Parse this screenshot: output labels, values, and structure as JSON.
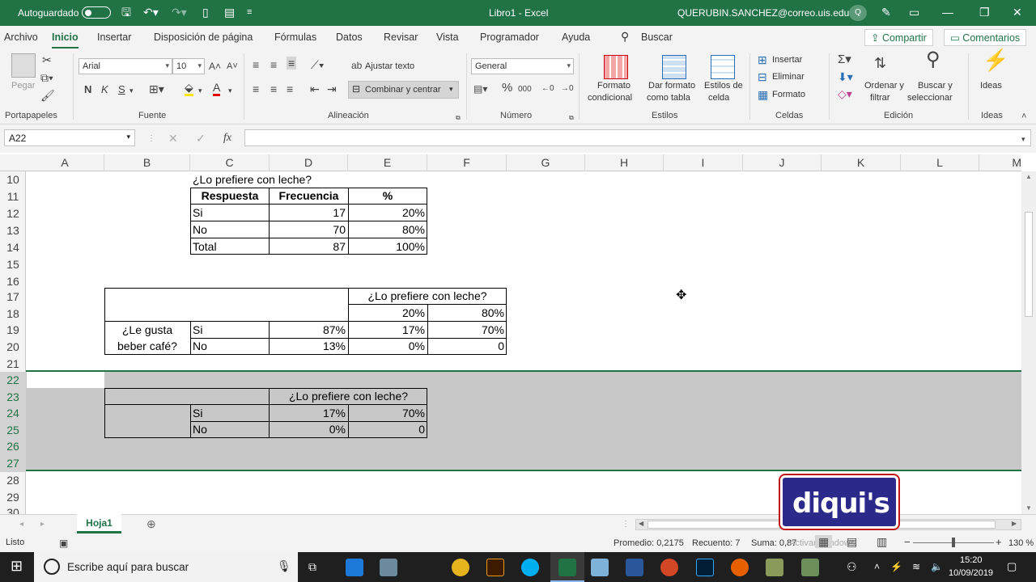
{
  "titlebar": {
    "autosave": "Autoguardado",
    "doc_title": "Libro1  -  Excel",
    "user": "QUERUBIN.SANCHEZ@correo.uis.edu.co",
    "user_initial": "Q"
  },
  "menu": {
    "items": [
      "Archivo",
      "Inicio",
      "Insertar",
      "Disposición de página",
      "Fórmulas",
      "Datos",
      "Revisar",
      "Vista",
      "Programador",
      "Ayuda"
    ],
    "search": "Buscar",
    "share": "Compartir",
    "comments": "Comentarios"
  },
  "ribbon": {
    "paste": "Pegar",
    "font_name": "Arial",
    "font_size": "10",
    "bold": "N",
    "italic": "K",
    "underline": "S",
    "wrap_text": "Ajustar texto",
    "merge_center": "Combinar y centrar",
    "number_format": "General",
    "cond_format": [
      "Formato",
      "condicional"
    ],
    "table_format": [
      "Dar formato",
      "como tabla"
    ],
    "cell_styles": [
      "Estilos de",
      "celda"
    ],
    "insert": "Insertar",
    "delete": "Eliminar",
    "format": "Formato",
    "sort_filter": [
      "Ordenar y",
      "filtrar"
    ],
    "find_select": [
      "Buscar y",
      "seleccionar"
    ],
    "ideas": "Ideas",
    "groups": [
      "Portapapeles",
      "Fuente",
      "Alineación",
      "Número",
      "Estilos",
      "Celdas",
      "Edición",
      "Ideas"
    ]
  },
  "formula_bar": {
    "name_box": "A22",
    "fx": "fx",
    "content": ""
  },
  "grid": {
    "columns": [
      "A",
      "B",
      "C",
      "D",
      "E",
      "F",
      "G",
      "H",
      "I",
      "J",
      "K",
      "L",
      "M"
    ],
    "rows": [
      "10",
      "11",
      "12",
      "13",
      "14",
      "15",
      "16",
      "17",
      "18",
      "19",
      "20",
      "21",
      "22",
      "23",
      "24",
      "25",
      "26",
      "27",
      "28",
      "29",
      "30"
    ],
    "table1": {
      "title": "¿Lo prefiere con leche?",
      "headers": [
        "Respuesta",
        "Frecuencia",
        "%"
      ],
      "rows": [
        [
          "Si",
          "17",
          "20%"
        ],
        [
          "No",
          "70",
          "80%"
        ],
        [
          "Total",
          "87",
          "100%"
        ]
      ]
    },
    "table2": {
      "header": "¿Lo prefiere con leche?",
      "pct_header": [
        "20%",
        "80%"
      ],
      "row_label": [
        "¿Le gusta",
        "beber café?"
      ],
      "rows": [
        [
          "Si",
          "87%",
          "17%",
          "70%"
        ],
        [
          "No",
          "13%",
          "0%",
          "0"
        ]
      ]
    },
    "table3": {
      "header": "¿Lo prefiere con leche?",
      "rows": [
        [
          "Si",
          "17%",
          "70%"
        ],
        [
          "No",
          "0%",
          "0"
        ]
      ]
    }
  },
  "sheet": {
    "tab": "Hoja1"
  },
  "status": {
    "ready": "Listo",
    "average": "Promedio: 0,2175",
    "count": "Recuento: 7",
    "sum": "Suma: 0,87",
    "zoom": "130 %",
    "watermark": "Activar Windows"
  },
  "overlay": {
    "logo": "diqui's"
  },
  "taskbar": {
    "search": "Escribe aquí para buscar",
    "time": "15:20",
    "date": "10/09/2019"
  }
}
